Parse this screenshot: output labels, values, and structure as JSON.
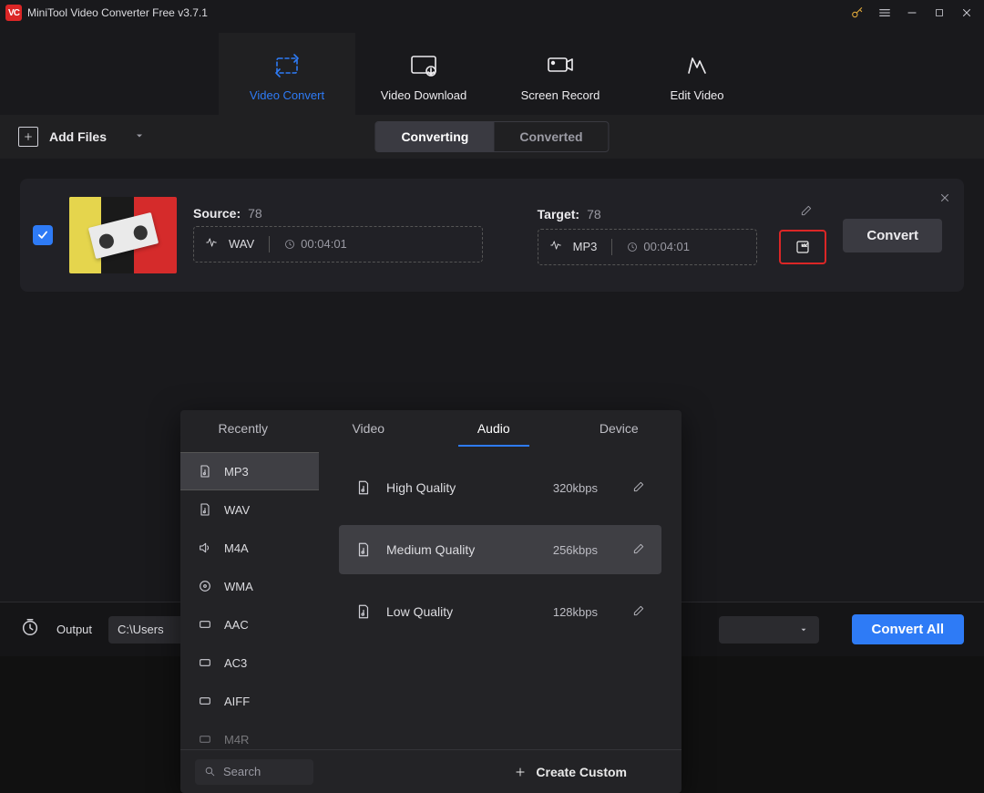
{
  "app": {
    "title": "MiniTool Video Converter Free v3.7.1",
    "logo_text": "VC"
  },
  "main_tabs": [
    {
      "label": "Video Convert",
      "active": true
    },
    {
      "label": "Video Download",
      "active": false
    },
    {
      "label": "Screen Record",
      "active": false
    },
    {
      "label": "Edit Video",
      "active": false
    }
  ],
  "toolbar": {
    "add_files": "Add Files",
    "segments": [
      {
        "label": "Converting",
        "active": true
      },
      {
        "label": "Converted",
        "active": false
      }
    ]
  },
  "file": {
    "source_label": "Source:",
    "source_name": "78",
    "source_fmt": "WAV",
    "source_dur": "00:04:01",
    "target_label": "Target:",
    "target_name": "78",
    "target_fmt": "MP3",
    "target_dur": "00:04:01",
    "convert": "Convert"
  },
  "popover": {
    "tabs": [
      "Recently",
      "Video",
      "Audio",
      "Device"
    ],
    "active_tab": "Audio",
    "formats": [
      "MP3",
      "WAV",
      "M4A",
      "WMA",
      "AAC",
      "AC3",
      "AIFF",
      "M4R"
    ],
    "active_format": "MP3",
    "qualities": [
      {
        "name": "High Quality",
        "rate": "320kbps",
        "selected": false
      },
      {
        "name": "Medium Quality",
        "rate": "256kbps",
        "selected": true
      },
      {
        "name": "Low Quality",
        "rate": "128kbps",
        "selected": false
      }
    ],
    "search_placeholder": "Search",
    "create_custom": "Create Custom"
  },
  "bottom": {
    "output_label": "Output",
    "output_path": "C:\\Users",
    "convert_all": "Convert All"
  }
}
